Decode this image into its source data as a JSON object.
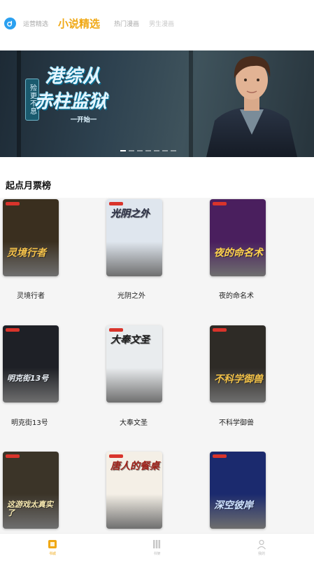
{
  "top_tabs": [
    {
      "label": "运营精选",
      "active": false
    },
    {
      "label": "小说精选",
      "active": true
    },
    {
      "label": "热门漫画",
      "active": false
    },
    {
      "label": "男生漫画",
      "active": false
    }
  ],
  "banner": {
    "tag": "殓更不息",
    "title_line1": "港综从",
    "title_line2": "赤柱监狱",
    "subtitle": "一开始一",
    "page_count": 7,
    "active_index": 0
  },
  "section": {
    "title": "起点月票榜"
  },
  "books": [
    {
      "name": "灵境行者",
      "cover_text": "灵境行者",
      "bg": "#3a2f1f",
      "accent": "#f5c24a"
    },
    {
      "name": "光阴之外",
      "cover_text": "光阴之外",
      "bg": "#dfe6ee",
      "accent": "#2b2f44"
    },
    {
      "name": "夜的命名术",
      "cover_text": "夜的命名术",
      "bg": "#4a1f5e",
      "accent": "#ffd34d"
    },
    {
      "name": "明克街13号",
      "cover_text": "明克街13号",
      "bg": "#1e2026",
      "accent": "#e8eef5"
    },
    {
      "name": "大奉文圣",
      "cover_text": "大奉文圣",
      "bg": "#e9ecee",
      "accent": "#1d1d1d"
    },
    {
      "name": "不科学御兽",
      "cover_text": "不科学御兽",
      "bg": "#2e2b26",
      "accent": "#f0c048"
    },
    {
      "name": "",
      "cover_text": "这游戏太真实了",
      "bg": "#3b3428",
      "accent": "#f6e8b0"
    },
    {
      "name": "",
      "cover_text": "唐人的餐桌",
      "bg": "#f4efe6",
      "accent": "#a0241c"
    },
    {
      "name": "",
      "cover_text": "深空彼岸",
      "bg": "#1b2a6e",
      "accent": "#cfe3ff"
    }
  ],
  "bottom_nav": [
    {
      "label": "书城",
      "icon": "home-icon",
      "active": true
    },
    {
      "label": "书架",
      "icon": "bookshelf-icon",
      "active": false
    },
    {
      "label": "我的",
      "icon": "profile-icon",
      "active": false
    }
  ],
  "colors": {
    "accent": "#f0a814",
    "logo": "#2aa0f0"
  }
}
